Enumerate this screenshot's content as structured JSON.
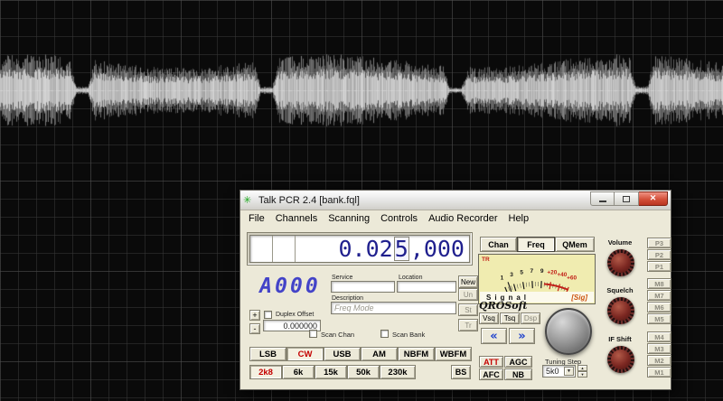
{
  "window": {
    "title": "Talk PCR 2.4 [bank.fql]",
    "titlebar": {
      "close": "✕"
    },
    "menu": [
      "File",
      "Channels",
      "Scanning",
      "Controls",
      "Audio Recorder",
      "Help"
    ],
    "freq_display": {
      "pre": "0.02",
      "cursor": "5",
      "post": ",000"
    },
    "display_tabs": [
      "Chan",
      "Freq",
      "QMem"
    ],
    "active_tab": "Freq",
    "meter": {
      "tr_label": "TR",
      "black_ticks": [
        "1",
        "3",
        "5",
        "7",
        "9"
      ],
      "red_ticks": [
        "+20",
        "+40",
        "+60"
      ],
      "label": "Signal",
      "sig_label": "[Sig]"
    },
    "memory_display": "A000",
    "record": {
      "service_label": "Service",
      "location_label": "Location",
      "description_label": "Description",
      "description_placeholder": "Freq Mode",
      "new_button": "New",
      "side_buttons": [
        "Un",
        "St",
        "Tr"
      ]
    },
    "duplex": {
      "plus": "+",
      "minus": "-",
      "label": "Duplex Offset",
      "value": "0.000000"
    },
    "brand": "QROSoft",
    "squelch_buttons": [
      "Vsq",
      "Tsq",
      "Dsp"
    ],
    "step_buttons": {
      "down": "«",
      "up": "»"
    },
    "scan": {
      "chan_label": "Scan Chan",
      "bank_label": "Scan Bank"
    },
    "modes": [
      "LSB",
      "CW",
      "USB",
      "AM",
      "NBFM",
      "WBFM"
    ],
    "active_mode": "CW",
    "filters": [
      "2k8",
      "6k",
      "15k",
      "50k",
      "230k"
    ],
    "active_filter": "2k8",
    "bs_button": "BS",
    "dsp": {
      "att": "ATT",
      "agc": "AGC",
      "afc": "AFC",
      "nb": "NB"
    },
    "tuning_step": {
      "label": "Tuning Step",
      "value": "5k0"
    },
    "knobs": {
      "volume": "Volume",
      "squelch": "Squelch",
      "ifshift": "IF Shift"
    },
    "preset_buttons": [
      "P3",
      "P2",
      "P1"
    ],
    "memory_buttons": [
      "M8",
      "M7",
      "M6",
      "M5",
      "M4",
      "M3",
      "M2",
      "M1"
    ],
    "colors": {
      "accent_red": "#c40000",
      "display_blue": "#20208e",
      "meter_bg": "#f0ecb0"
    }
  }
}
